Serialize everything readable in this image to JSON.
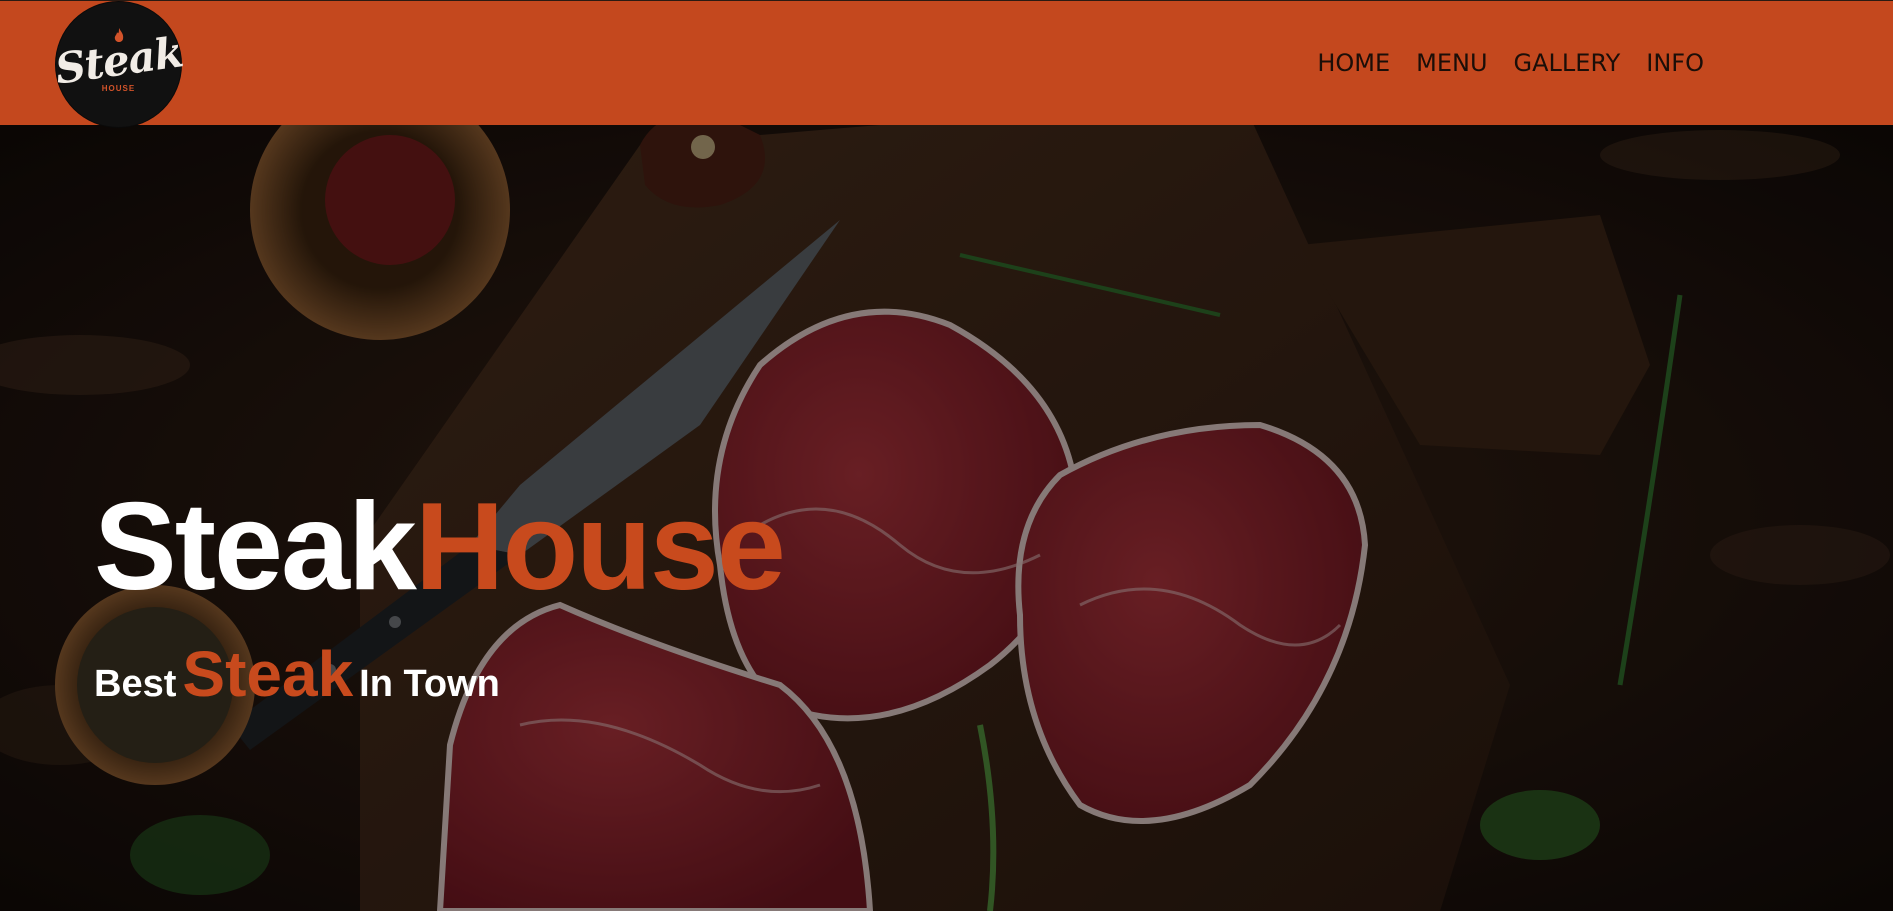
{
  "logo": {
    "name": "Steak",
    "sub": "HOUSE"
  },
  "nav": {
    "items": [
      "HOME",
      "MENU",
      "GALLERY",
      "INFO"
    ]
  },
  "hero": {
    "title_part1": "Steak",
    "title_part2": "House",
    "tagline_part1": "Best",
    "tagline_part2": "Steak",
    "tagline_part3": "In Town"
  },
  "colors": {
    "header_bg": "#c4481e",
    "accent": "#c84a1d",
    "text_light": "#ffffff",
    "nav_text": "#1b0e08"
  }
}
